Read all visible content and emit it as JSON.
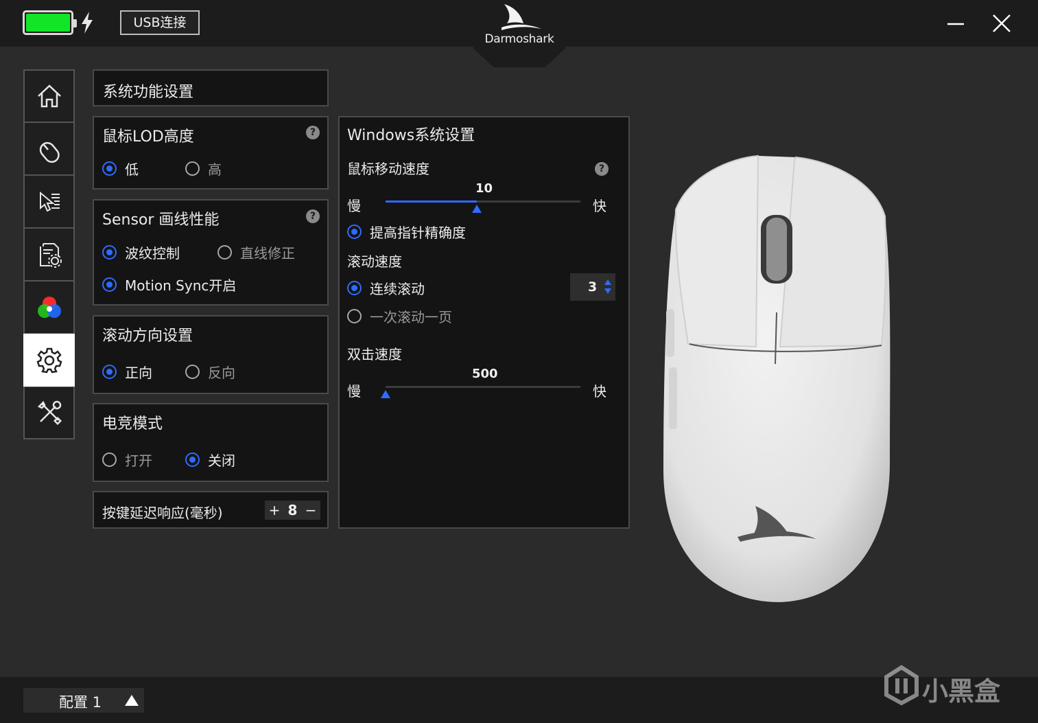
{
  "topbar": {
    "battery_level": 1.0,
    "battery_color": "#12e528",
    "charging_icon": "lightning-bolt-icon",
    "connection_label": "USB连接",
    "brand": "Darmoshark",
    "minimize_icon": "minimize-icon",
    "close_icon": "close-icon"
  },
  "sidebar": {
    "items": [
      {
        "icon": "home-icon",
        "active": false
      },
      {
        "icon": "mouse-icon",
        "active": false
      },
      {
        "icon": "pointer-settings-icon",
        "active": false
      },
      {
        "icon": "macro-document-icon",
        "active": false
      },
      {
        "icon": "rgb-lighting-icon",
        "active": false
      },
      {
        "icon": "gear-icon",
        "active": true
      },
      {
        "icon": "tools-icon",
        "active": false
      }
    ]
  },
  "system": {
    "title": "系统功能设置",
    "lod": {
      "title": "鼠标LOD高度",
      "options": [
        {
          "label": "低",
          "selected": true
        },
        {
          "label": "高",
          "selected": false
        }
      ]
    },
    "sensor": {
      "title": "Sensor 画线性能",
      "options": [
        {
          "label": "波纹控制",
          "selected": true
        },
        {
          "label": "直线修正",
          "selected": false
        },
        {
          "label": "Motion Sync开启",
          "selected": true
        }
      ]
    },
    "scroll_direction": {
      "title": "滚动方向设置",
      "options": [
        {
          "label": "正向",
          "selected": true
        },
        {
          "label": "反向",
          "selected": false
        }
      ]
    },
    "esports": {
      "title": "电竞模式",
      "options": [
        {
          "label": "打开",
          "selected": false
        },
        {
          "label": "关闭",
          "selected": true
        }
      ]
    },
    "debounce": {
      "label": "按键延迟响应(毫秒)",
      "plus": "+",
      "value": "8",
      "minus": "−"
    }
  },
  "windows": {
    "title": "Windows系统设置",
    "pointer_speed": {
      "label": "鼠标移动速度",
      "value": "10",
      "slow": "慢",
      "fast": "快",
      "fraction": 0.47
    },
    "enhance_precision": {
      "label": "提高指针精确度",
      "selected": true
    },
    "scroll_speed": {
      "label": "滚动速度",
      "continuous": {
        "label": "连续滚动",
        "selected": true
      },
      "page": {
        "label": "一次滚动一页",
        "selected": false
      },
      "lines": "3"
    },
    "double_click": {
      "label": "双击速度",
      "value": "500",
      "slow": "慢",
      "fast": "快",
      "fraction": 0.0
    }
  },
  "bottom": {
    "profile_label": "配置 1",
    "watermark": "小黑盒"
  },
  "colors": {
    "accent": "#2f6bff",
    "panel": "#141414",
    "background": "#2b2b2b"
  }
}
